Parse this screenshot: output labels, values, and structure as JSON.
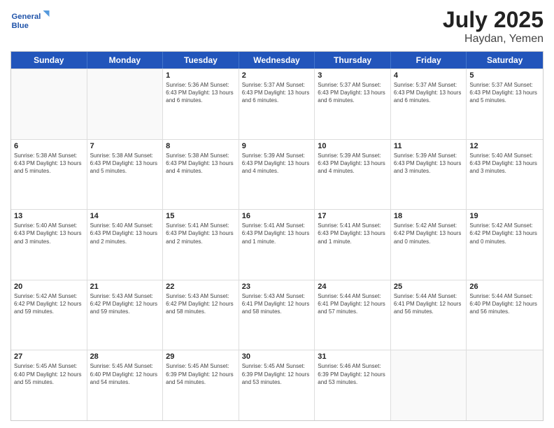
{
  "logo": {
    "line1": "General",
    "line2": "Blue"
  },
  "title": {
    "month_year": "July 2025",
    "location": "Haydan, Yemen"
  },
  "days_of_week": [
    "Sunday",
    "Monday",
    "Tuesday",
    "Wednesday",
    "Thursday",
    "Friday",
    "Saturday"
  ],
  "weeks": [
    [
      {
        "day": "",
        "info": ""
      },
      {
        "day": "",
        "info": ""
      },
      {
        "day": "1",
        "info": "Sunrise: 5:36 AM\nSunset: 6:43 PM\nDaylight: 13 hours\nand 6 minutes."
      },
      {
        "day": "2",
        "info": "Sunrise: 5:37 AM\nSunset: 6:43 PM\nDaylight: 13 hours\nand 6 minutes."
      },
      {
        "day": "3",
        "info": "Sunrise: 5:37 AM\nSunset: 6:43 PM\nDaylight: 13 hours\nand 6 minutes."
      },
      {
        "day": "4",
        "info": "Sunrise: 5:37 AM\nSunset: 6:43 PM\nDaylight: 13 hours\nand 6 minutes."
      },
      {
        "day": "5",
        "info": "Sunrise: 5:37 AM\nSunset: 6:43 PM\nDaylight: 13 hours\nand 5 minutes."
      }
    ],
    [
      {
        "day": "6",
        "info": "Sunrise: 5:38 AM\nSunset: 6:43 PM\nDaylight: 13 hours\nand 5 minutes."
      },
      {
        "day": "7",
        "info": "Sunrise: 5:38 AM\nSunset: 6:43 PM\nDaylight: 13 hours\nand 5 minutes."
      },
      {
        "day": "8",
        "info": "Sunrise: 5:38 AM\nSunset: 6:43 PM\nDaylight: 13 hours\nand 4 minutes."
      },
      {
        "day": "9",
        "info": "Sunrise: 5:39 AM\nSunset: 6:43 PM\nDaylight: 13 hours\nand 4 minutes."
      },
      {
        "day": "10",
        "info": "Sunrise: 5:39 AM\nSunset: 6:43 PM\nDaylight: 13 hours\nand 4 minutes."
      },
      {
        "day": "11",
        "info": "Sunrise: 5:39 AM\nSunset: 6:43 PM\nDaylight: 13 hours\nand 3 minutes."
      },
      {
        "day": "12",
        "info": "Sunrise: 5:40 AM\nSunset: 6:43 PM\nDaylight: 13 hours\nand 3 minutes."
      }
    ],
    [
      {
        "day": "13",
        "info": "Sunrise: 5:40 AM\nSunset: 6:43 PM\nDaylight: 13 hours\nand 3 minutes."
      },
      {
        "day": "14",
        "info": "Sunrise: 5:40 AM\nSunset: 6:43 PM\nDaylight: 13 hours\nand 2 minutes."
      },
      {
        "day": "15",
        "info": "Sunrise: 5:41 AM\nSunset: 6:43 PM\nDaylight: 13 hours\nand 2 minutes."
      },
      {
        "day": "16",
        "info": "Sunrise: 5:41 AM\nSunset: 6:43 PM\nDaylight: 13 hours\nand 1 minute."
      },
      {
        "day": "17",
        "info": "Sunrise: 5:41 AM\nSunset: 6:43 PM\nDaylight: 13 hours\nand 1 minute."
      },
      {
        "day": "18",
        "info": "Sunrise: 5:42 AM\nSunset: 6:42 PM\nDaylight: 13 hours\nand 0 minutes."
      },
      {
        "day": "19",
        "info": "Sunrise: 5:42 AM\nSunset: 6:42 PM\nDaylight: 13 hours\nand 0 minutes."
      }
    ],
    [
      {
        "day": "20",
        "info": "Sunrise: 5:42 AM\nSunset: 6:42 PM\nDaylight: 12 hours\nand 59 minutes."
      },
      {
        "day": "21",
        "info": "Sunrise: 5:43 AM\nSunset: 6:42 PM\nDaylight: 12 hours\nand 59 minutes."
      },
      {
        "day": "22",
        "info": "Sunrise: 5:43 AM\nSunset: 6:42 PM\nDaylight: 12 hours\nand 58 minutes."
      },
      {
        "day": "23",
        "info": "Sunrise: 5:43 AM\nSunset: 6:41 PM\nDaylight: 12 hours\nand 58 minutes."
      },
      {
        "day": "24",
        "info": "Sunrise: 5:44 AM\nSunset: 6:41 PM\nDaylight: 12 hours\nand 57 minutes."
      },
      {
        "day": "25",
        "info": "Sunrise: 5:44 AM\nSunset: 6:41 PM\nDaylight: 12 hours\nand 56 minutes."
      },
      {
        "day": "26",
        "info": "Sunrise: 5:44 AM\nSunset: 6:40 PM\nDaylight: 12 hours\nand 56 minutes."
      }
    ],
    [
      {
        "day": "27",
        "info": "Sunrise: 5:45 AM\nSunset: 6:40 PM\nDaylight: 12 hours\nand 55 minutes."
      },
      {
        "day": "28",
        "info": "Sunrise: 5:45 AM\nSunset: 6:40 PM\nDaylight: 12 hours\nand 54 minutes."
      },
      {
        "day": "29",
        "info": "Sunrise: 5:45 AM\nSunset: 6:39 PM\nDaylight: 12 hours\nand 54 minutes."
      },
      {
        "day": "30",
        "info": "Sunrise: 5:45 AM\nSunset: 6:39 PM\nDaylight: 12 hours\nand 53 minutes."
      },
      {
        "day": "31",
        "info": "Sunrise: 5:46 AM\nSunset: 6:39 PM\nDaylight: 12 hours\nand 53 minutes."
      },
      {
        "day": "",
        "info": ""
      },
      {
        "day": "",
        "info": ""
      }
    ]
  ]
}
